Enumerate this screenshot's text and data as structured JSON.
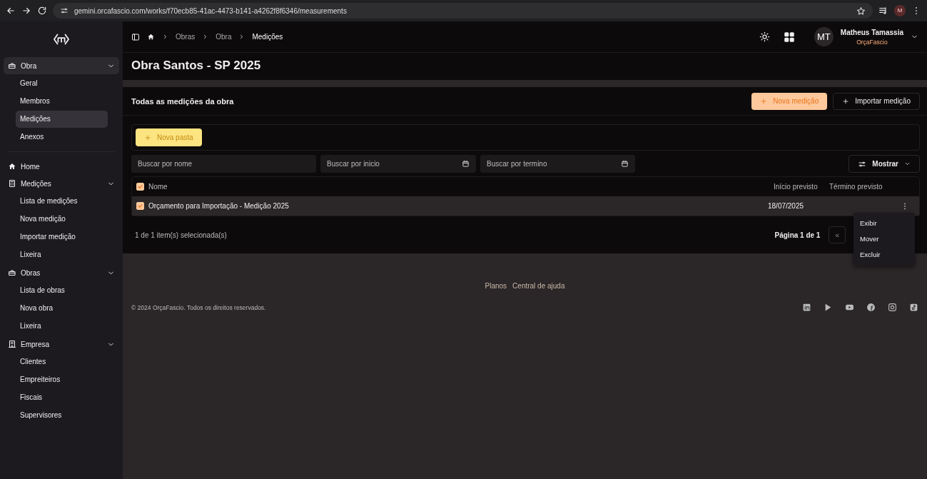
{
  "browser": {
    "url": "gemini.orcafascio.com/works/f70ecb85-41ac-4473-b141-a4262f8f6346/measurements",
    "profile": "M"
  },
  "sidebar": {
    "groups": [
      {
        "label": "Obra",
        "expanded": true,
        "selected": true,
        "children": [
          {
            "label": "Geral",
            "selected": false
          },
          {
            "label": "Membros",
            "selected": false
          },
          {
            "label": "Medições",
            "selected": true
          },
          {
            "label": "Anexos",
            "selected": false
          }
        ]
      },
      {
        "label": "Home",
        "selected": false
      },
      {
        "label": "Medições",
        "expanded": true,
        "selected": false,
        "children": [
          {
            "label": "Lista de medições",
            "selected": false
          },
          {
            "label": "Nova medição",
            "selected": false
          },
          {
            "label": "Importar medição",
            "selected": false
          },
          {
            "label": "Lixeira",
            "selected": false
          }
        ]
      },
      {
        "label": "Obras",
        "expanded": true,
        "selected": false,
        "children": [
          {
            "label": "Lista de obras",
            "selected": false
          },
          {
            "label": "Nova obra",
            "selected": false
          },
          {
            "label": "Lixeira",
            "selected": false
          }
        ]
      },
      {
        "label": "Empresa",
        "expanded": true,
        "selected": false,
        "children": [
          {
            "label": "Clientes",
            "selected": false
          },
          {
            "label": "Empreiteiros",
            "selected": false
          },
          {
            "label": "Fiscais",
            "selected": false
          },
          {
            "label": "Supervisores",
            "selected": false
          }
        ]
      }
    ]
  },
  "breadcrumb": [
    {
      "label": "Obras",
      "selected": false
    },
    {
      "label": "Obra",
      "selected": false
    },
    {
      "label": "Medições",
      "selected": true
    }
  ],
  "user": {
    "initials": "MT",
    "name": "Matheus Tamassia",
    "company": "OrçaFascio"
  },
  "page_title": "Obra Santos - SP 2025",
  "section_title": "Todas as medições da obra",
  "actions": [
    {
      "label": "Nova medição",
      "kind": "primary"
    },
    {
      "label": "Importar medição",
      "kind": "outline"
    }
  ],
  "new_folder": "Nova pasta",
  "filters": [
    {
      "placeholder": "Buscar por nome",
      "kind": "text"
    },
    {
      "placeholder": "Buscar por inicio",
      "kind": "date"
    },
    {
      "placeholder": "Buscar por termino",
      "kind": "date"
    }
  ],
  "columns_button": "Mostrar",
  "table": {
    "all_checked": true,
    "columns": [
      "Nome",
      "Início previsto",
      "Término previsto"
    ],
    "rows": [
      {
        "checked": true,
        "cells": [
          "Orçamento para Importação - Medição 2025",
          "18/07/2025",
          ""
        ]
      }
    ]
  },
  "selection_text": "1 de 1 item(s) selecionada(s)",
  "pagination": {
    "label": "Página 1 de 1",
    "first": "«"
  },
  "row_menu": [
    "Exibir",
    "Mover",
    "Excluir"
  ],
  "footer": {
    "links": [
      "Planos",
      "Central de ajuda"
    ],
    "copyright": "© 2024 OrçaFascio. Todos os direitos reservados."
  }
}
